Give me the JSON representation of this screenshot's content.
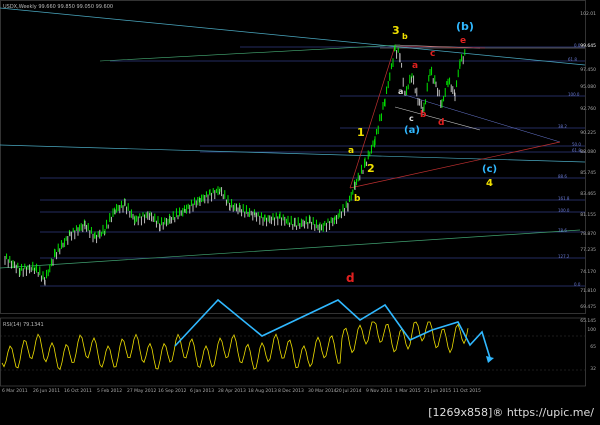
{
  "header": {
    "symbol_line": "USDX,Weekly  99.660  99.850  99.050  99.600",
    "rsi_label": "RSI(14) 79.1341"
  },
  "price_axis": {
    "labels": [
      "102.01",
      "99.645",
      "97.450",
      "95.080",
      "92.760",
      "90.225",
      "88.080",
      "85.745",
      "83.465",
      "81.155",
      "78.870",
      "77.235",
      "74.170",
      "71.810",
      "69.475",
      "65.145"
    ],
    "highlight": [
      "99.645"
    ]
  },
  "rsi_axis": {
    "labels": [
      "100",
      "65",
      "32"
    ]
  },
  "date_axis": {
    "labels": [
      "6 Mar 2011",
      "26 Jun 2011",
      "16 Oct 2011",
      "5 Feb 2012",
      "27 May 2012",
      "16 Sep 2012",
      "6 Jan 2013",
      "28 Apr 2013",
      "18 Aug 2013",
      "8 Dec 2013",
      "30 Mar 2014",
      "20 Jul 2014",
      "9 Nov 2014",
      "1 Mar 2015",
      "21 Jun 2015",
      "11 Oct 2015"
    ]
  },
  "fib_labels": [
    "0.0",
    "61.8",
    "100.0",
    "38.2",
    "50.0",
    "61.8",
    "88.6",
    "161.8",
    "100.0",
    "78.6",
    "127.2",
    "0.0"
  ],
  "waves": {
    "w3": "3",
    "wb_paren": "(b)",
    "wb": "b",
    "wa_red": "a",
    "wc_red": "c",
    "we_red": "e",
    "wa_white": "a",
    "wc_white": "c",
    "wb_red": "b",
    "wd_red": "d",
    "wa_paren": "(a)",
    "w1": "1",
    "wa_yellow": "a",
    "w2": "2",
    "wc_paren": "(c)",
    "w4": "4",
    "wb_yellow": "b",
    "wd_main": "d"
  },
  "watermark": "[1269x858]® https://upic.me/",
  "colors": {
    "background": "#000000",
    "bull_bar": "#00ff00",
    "bear_bar": "#d0d0d0",
    "rsi": "#f0e000",
    "fib": "#5060d0",
    "trend": "#48b0c8",
    "zigzag": "#30b8ff",
    "red": "#e02020",
    "yellow": "#f0e000"
  }
}
